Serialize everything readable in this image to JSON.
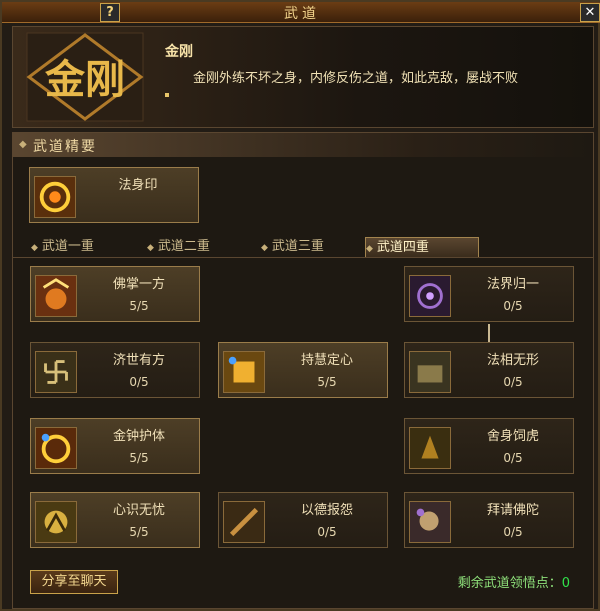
{
  "window": {
    "title": "武道"
  },
  "titlebar": {
    "help_label": "?",
    "close_label": "✕"
  },
  "header": {
    "emblem_text": "金刚",
    "skill_name": "金刚",
    "description": "金刚外练不坏之身，内修反伤之道，如此克敌，屡战不败",
    "bullet_color": "#e8c66a"
  },
  "section": {
    "title": "武道精要"
  },
  "essence_skill": {
    "name": "法身印",
    "icon": "golden-sigil-icon"
  },
  "tabs": [
    {
      "label": "武道一重",
      "selected": false
    },
    {
      "label": "武道二重",
      "selected": false
    },
    {
      "label": "武道三重",
      "selected": false
    },
    {
      "label": "武道四重",
      "selected": true
    }
  ],
  "skills": [
    {
      "name": "佛掌一方",
      "level": "5/5",
      "icon": "buddha-palm-icon",
      "active": true
    },
    {
      "name": "济世有方",
      "level": "0/5",
      "icon": "swastika-icon",
      "active": false
    },
    {
      "name": "金钟护体",
      "level": "5/5",
      "icon": "golden-bell-icon",
      "active": true
    },
    {
      "name": "心识无忧",
      "level": "5/5",
      "icon": "mind-icon",
      "active": false
    },
    {
      "name": "持慧定心",
      "level": "5/5",
      "icon": "wisdom-icon",
      "active": true
    },
    {
      "name": "以德报怨",
      "level": "0/5",
      "icon": "virtue-icon",
      "active": false
    },
    {
      "name": "法界归一",
      "level": "0/5",
      "icon": "dharma-realm-icon",
      "active": false
    },
    {
      "name": "法相无形",
      "level": "0/5",
      "icon": "dharma-form-icon",
      "active": false
    },
    {
      "name": "舍身饲虎",
      "level": "0/5",
      "icon": "sacrifice-icon",
      "active": false
    },
    {
      "name": "拜请佛陀",
      "level": "0/5",
      "icon": "pray-buddha-icon",
      "active": false
    }
  ],
  "footer": {
    "share_label": "分享至聊天",
    "remaining_label": "剩余武道领悟点：",
    "remaining_value": "0"
  }
}
